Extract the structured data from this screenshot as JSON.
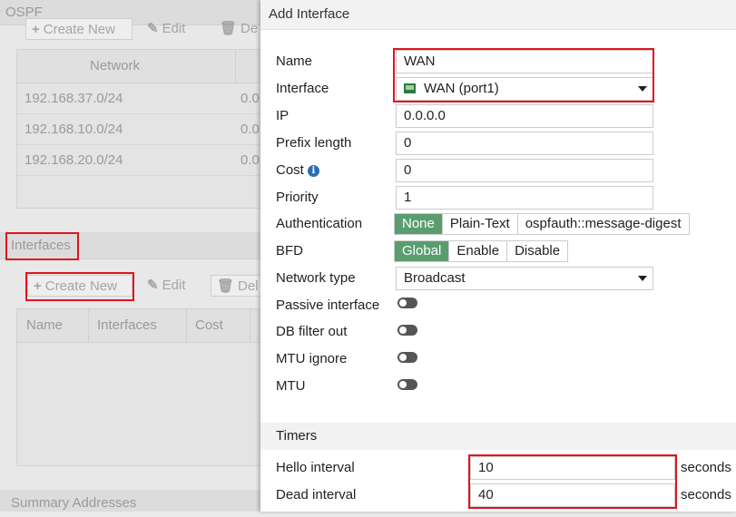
{
  "background": {
    "ospf_title": "OSPF",
    "top_toolbar": {
      "create_new": "Create New",
      "edit": "Edit",
      "delete": "De"
    },
    "networks_table": {
      "header": "Network",
      "rows": [
        {
          "network": "192.168.37.0/24",
          "area": "0.0"
        },
        {
          "network": "192.168.10.0/24",
          "area": "0.0"
        },
        {
          "network": "192.168.20.0/24",
          "area": "0.0"
        }
      ]
    },
    "interfaces_section": "Interfaces",
    "interfaces_toolbar": {
      "create_new": "Create New",
      "edit": "Edit",
      "delete": "Del"
    },
    "interfaces_table": {
      "columns": [
        "Name",
        "Interfaces",
        "Cost"
      ]
    },
    "summary_section": "Summary Addresses"
  },
  "dialog": {
    "title": "Add Interface",
    "name": {
      "label": "Name",
      "value": "WAN"
    },
    "interface": {
      "label": "Interface",
      "value": "WAN (port1)"
    },
    "ip": {
      "label": "IP",
      "value": "0.0.0.0"
    },
    "prefix_length": {
      "label": "Prefix length",
      "value": "0"
    },
    "cost": {
      "label": "Cost",
      "value": "0"
    },
    "priority": {
      "label": "Priority",
      "value": "1"
    },
    "authentication": {
      "label": "Authentication",
      "options": [
        "None",
        "Plain-Text",
        "ospfauth::message-digest"
      ],
      "selected": "None"
    },
    "bfd": {
      "label": "BFD",
      "options": [
        "Global",
        "Enable",
        "Disable"
      ],
      "selected": "Global"
    },
    "network_type": {
      "label": "Network type",
      "value": "Broadcast"
    },
    "passive_interface": {
      "label": "Passive interface",
      "enabled": false
    },
    "db_filter_out": {
      "label": "DB filter out",
      "enabled": false
    },
    "mtu_ignore": {
      "label": "MTU ignore",
      "enabled": false
    },
    "mtu": {
      "label": "MTU",
      "enabled": false
    },
    "timers": {
      "title": "Timers",
      "hello_interval": {
        "label": "Hello interval",
        "value": "10",
        "unit": "seconds"
      },
      "dead_interval": {
        "label": "Dead interval",
        "value": "40",
        "unit": "seconds"
      }
    }
  },
  "colors": {
    "highlight": "#e0141e",
    "selected_segment": "#5a9e6f",
    "info_icon": "#2a6fb5"
  }
}
